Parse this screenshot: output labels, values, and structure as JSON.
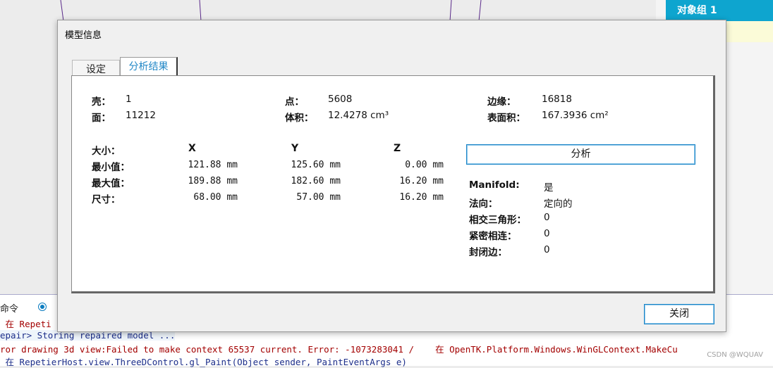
{
  "right_panel": {
    "header": "对象组 1"
  },
  "log": {
    "command_label": "命令",
    "lines": [
      " 在 Repeti",
      "epair> Storing repaired model ...",
      "ror drawing 3d view:Failed to make context 65537 current. Error: -1073283041 /    在 OpenTK.Platform.Windows.WinGLContext.MakeCu",
      " 在 RepetierHost.view.ThreeDControl.gl_Paint(Object sender, PaintEventArgs e)"
    ]
  },
  "watermark": "CSDN @WQUAV",
  "dialog": {
    "title": "模型信息",
    "tabs": [
      {
        "label": "设定"
      },
      {
        "label": "分析结果"
      }
    ],
    "stats": {
      "shells_label": "壳：",
      "shells": "1",
      "faces_label": "面：",
      "faces": "11212",
      "points_label": "点：",
      "points": "5608",
      "volume_label": "体积：",
      "volume": "12.4278 cm³",
      "edges_label": "边缘：",
      "edges": "16818",
      "area_label": "表面积：",
      "area": "167.3936 cm²"
    },
    "dims": {
      "size_label": "大小：",
      "columns": [
        "X",
        "Y",
        "Z"
      ],
      "rows": [
        {
          "label": "最小值：",
          "x": "121.88 mm",
          "y": "125.60 mm",
          "z": "0.00 mm"
        },
        {
          "label": "最大值：",
          "x": "189.88 mm",
          "y": "182.60 mm",
          "z": "16.20 mm"
        },
        {
          "label": "尺寸：",
          "x": "68.00 mm",
          "y": "57.00 mm",
          "z": "16.20 mm"
        }
      ]
    },
    "analyze_button": "分析",
    "analysis": [
      {
        "label": "Manifold:",
        "value": "是"
      },
      {
        "label": "法向：",
        "value": "定向的"
      },
      {
        "label": "相交三角形：",
        "value": "0"
      },
      {
        "label": "紧密相连：",
        "value": "0"
      },
      {
        "label": "封闭边：",
        "value": "0"
      }
    ],
    "close_button": "关闭"
  }
}
